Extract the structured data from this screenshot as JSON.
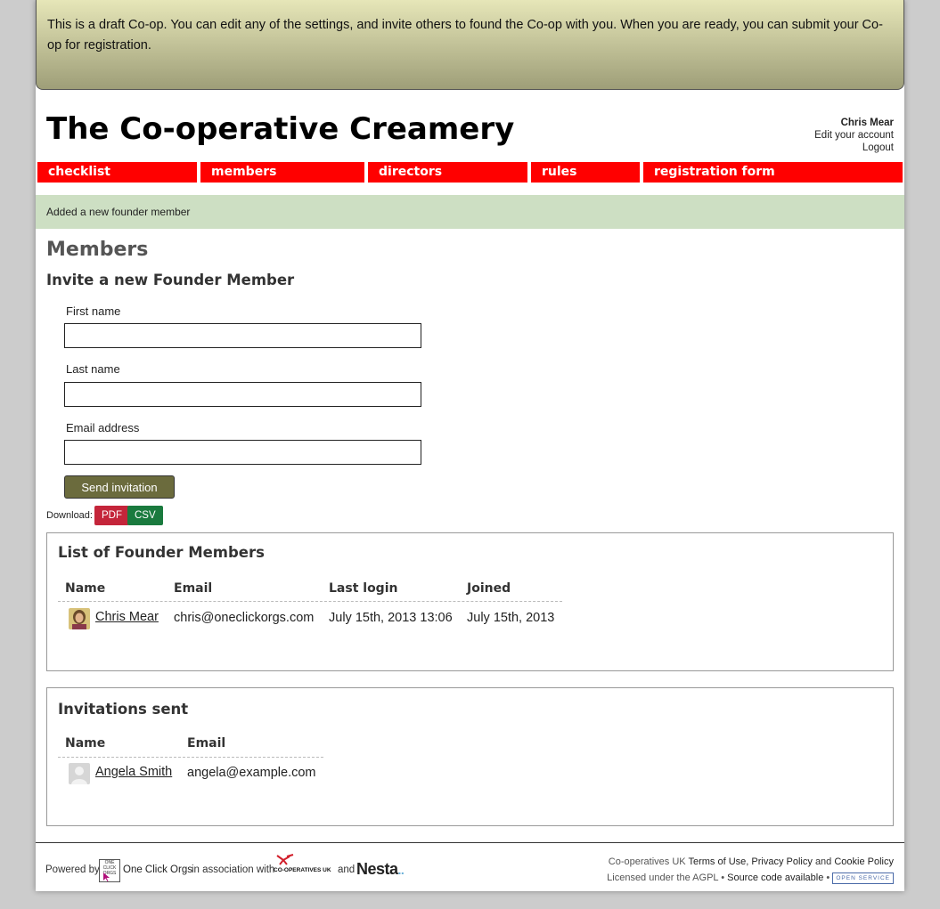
{
  "banner": {
    "text": "This is a draft Co-op. You can edit any of the settings, and invite others to found the Co-op with you. When you are ready, you can submit your Co-op for registration."
  },
  "site": {
    "title": "The Co-operative Creamery"
  },
  "user": {
    "name": "Chris Mear",
    "edit_account": "Edit your account",
    "logout": "Logout"
  },
  "nav": {
    "items": [
      {
        "label": "checklist"
      },
      {
        "label": "members"
      },
      {
        "label": "directors"
      },
      {
        "label": "rules"
      },
      {
        "label": "registration form"
      }
    ],
    "color": "#ff0000"
  },
  "flash": {
    "message": "Added a new founder member"
  },
  "page": {
    "heading": "Members",
    "invite_heading": "Invite a new Founder Member"
  },
  "form": {
    "first_name_label": "First name",
    "first_name_value": "",
    "last_name_label": "Last name",
    "last_name_value": "",
    "email_label": "Email address",
    "email_value": "",
    "submit_label": "Send invitation"
  },
  "download": {
    "label": "Download:",
    "pdf": "PDF",
    "csv": "CSV",
    "pdf_color": "#c4253a",
    "csv_color": "#1a7a3e"
  },
  "founders": {
    "heading": "List of Founder Members",
    "columns": [
      "Name",
      "Email",
      "Last login",
      "Joined"
    ],
    "rows": [
      {
        "name": "Chris Mear",
        "email": "chris@oneclickorgs.com",
        "last_login": "July 15th, 2013 13:06",
        "joined": "July 15th, 2013",
        "avatar": "photo-avatar"
      }
    ]
  },
  "invitations": {
    "heading": "Invitations sent",
    "columns": [
      "Name",
      "Email"
    ],
    "rows": [
      {
        "name": "Angela Smith",
        "email": "angela@example.com",
        "avatar": "placeholder-avatar"
      }
    ]
  },
  "footer": {
    "powered_by": "Powered by",
    "oco_logo_text": "ONE CLICK ORGS",
    "oco_link": "One Click Orgs",
    "association": "in association with",
    "coops_logo_text": "CO-OPERATIVES UK",
    "and": "and",
    "nesta": "Nesta",
    "coops_uk": "Co-operatives UK",
    "terms": "Terms of Use",
    "privacy": "Privacy Policy",
    "and2": "and",
    "cookie": "Cookie Policy",
    "licensed": "Licensed under the",
    "agpl": "AGPL",
    "source": "Source code available",
    "open_service_badge": "OPEN SERVICE"
  }
}
